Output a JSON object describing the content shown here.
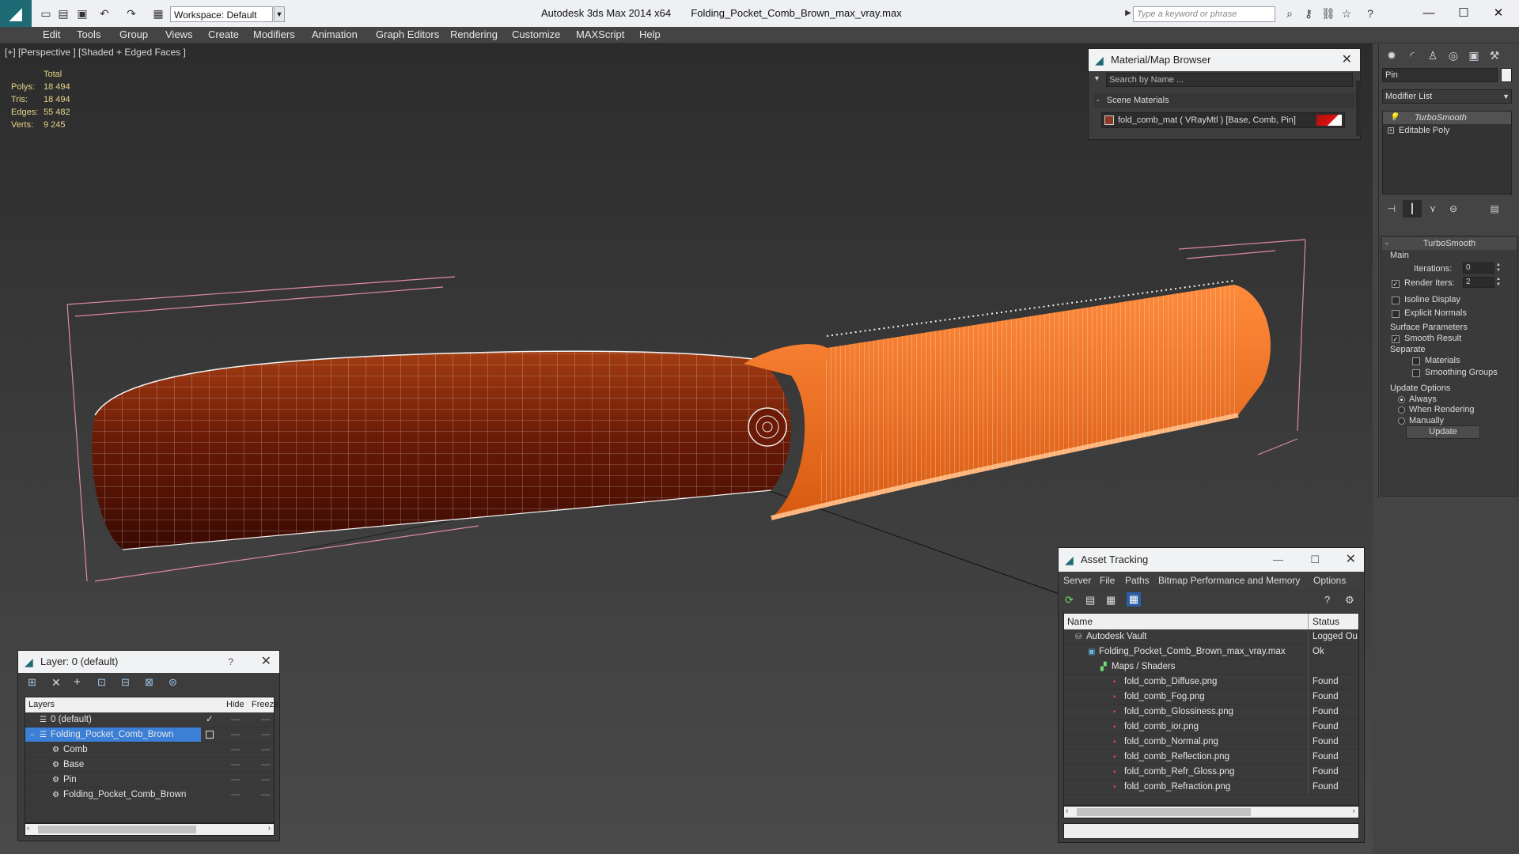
{
  "app": {
    "title": "Autodesk 3ds Max  2014 x64",
    "file": "Folding_Pocket_Comb_Brown_max_vray.max",
    "workspace": "Workspace: Default",
    "search_placeholder": "Type a keyword or phrase"
  },
  "menu": [
    "Edit",
    "Tools",
    "Group",
    "Views",
    "Create",
    "Modifiers",
    "Animation",
    "Graph Editors",
    "Rendering",
    "Customize",
    "MAXScript",
    "Help"
  ],
  "viewport": {
    "label": "[+] [Perspective ] [Shaded + Edged Faces ]",
    "stats_header": "Total",
    "stats": [
      {
        "label": "Polys:",
        "value": "18 494"
      },
      {
        "label": "Tris:",
        "value": "18 494"
      },
      {
        "label": "Edges:",
        "value": "55 482"
      },
      {
        "label": "Verts:",
        "value": "9 245"
      }
    ]
  },
  "material_browser": {
    "title": "Material/Map Browser",
    "search_placeholder": "Search by Name ...",
    "section": "Scene Materials",
    "item": "fold_comb_mat  ( VRayMtl )  [Base, Comb, Pin]"
  },
  "command_panel": {
    "name_field": "Pin",
    "modifier_list": "Modifier List",
    "stack": [
      "TurboSmooth",
      "Editable Poly"
    ],
    "rollout_title": "TurboSmooth",
    "main_label": "Main",
    "iterations_label": "Iterations:",
    "iterations_value": "0",
    "render_iters_label": "Render Iters:",
    "render_iters_value": "2",
    "isoline_label": "Isoline Display",
    "explicit_normals_label": "Explicit Normals",
    "surface_params_label": "Surface Parameters",
    "smooth_result_label": "Smooth Result",
    "separate_label": "Separate",
    "materials_label": "Materials",
    "smoothing_groups_label": "Smoothing Groups",
    "update_options_label": "Update Options",
    "always_label": "Always",
    "when_rendering_label": "When Rendering",
    "manually_label": "Manually",
    "update_button": "Update"
  },
  "layer_panel": {
    "title": "Layer: 0 (default)",
    "help": "?",
    "columns": {
      "layers": "Layers",
      "hide": "Hide",
      "freeze": "Freeze"
    },
    "rows": [
      {
        "name": "0 (default)",
        "indent": 0
      },
      {
        "name": "Folding_Pocket_Comb_Brown",
        "indent": 0
      },
      {
        "name": "Comb",
        "indent": 1
      },
      {
        "name": "Base",
        "indent": 1
      },
      {
        "name": "Pin",
        "indent": 1
      },
      {
        "name": "Folding_Pocket_Comb_Brown",
        "indent": 1
      }
    ]
  },
  "asset_tracking": {
    "title": "Asset Tracking",
    "menu": [
      "Server",
      "File",
      "Paths",
      "Bitmap Performance and Memory",
      "Options"
    ],
    "columns": {
      "name": "Name",
      "status": "Status"
    },
    "rows": [
      {
        "name": "Autodesk Vault",
        "status": "Logged Ou",
        "indent": 0
      },
      {
        "name": "Folding_Pocket_Comb_Brown_max_vray.max",
        "status": "Ok",
        "indent": 1
      },
      {
        "name": "Maps / Shaders",
        "status": "",
        "indent": 2
      },
      {
        "name": "fold_comb_Diffuse.png",
        "status": "Found",
        "indent": 3
      },
      {
        "name": "fold_comb_Fog.png",
        "status": "Found",
        "indent": 3
      },
      {
        "name": "fold_comb_Glossiness.png",
        "status": "Found",
        "indent": 3
      },
      {
        "name": "fold_comb_ior.png",
        "status": "Found",
        "indent": 3
      },
      {
        "name": "fold_comb_Normal.png",
        "status": "Found",
        "indent": 3
      },
      {
        "name": "fold_comb_Reflection.png",
        "status": "Found",
        "indent": 3
      },
      {
        "name": "fold_comb_Refr_Gloss.png",
        "status": "Found",
        "indent": 3
      },
      {
        "name": "fold_comb_Refraction.png",
        "status": "Found",
        "indent": 3
      }
    ]
  }
}
